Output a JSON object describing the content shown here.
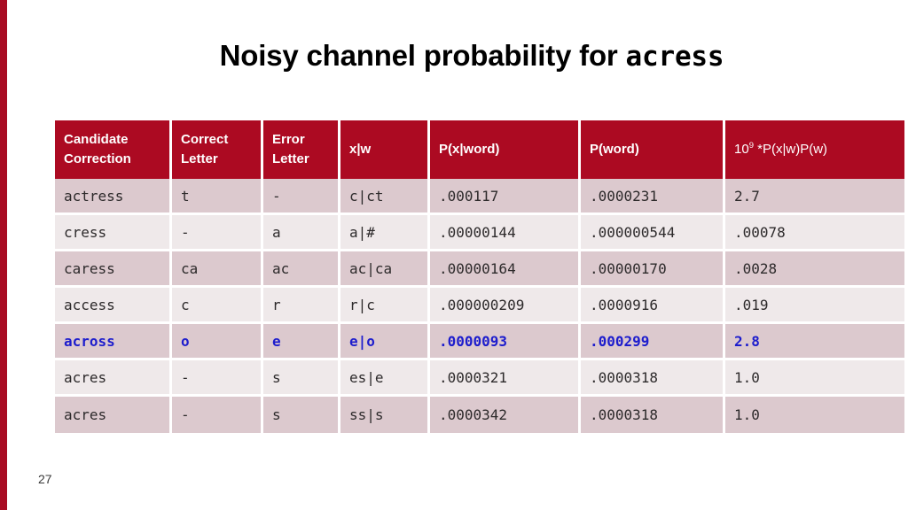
{
  "slide": {
    "title_prefix": "Noisy channel probability for ",
    "title_word": "acress",
    "page_number": "27",
    "accent_red": "#ac0a22",
    "highlight_blue": "#1d1dcd",
    "row_dark": "#dcc9ce",
    "row_light": "#efe9ea"
  },
  "table": {
    "headers": [
      {
        "line1": "Candidate",
        "line2": "Correction"
      },
      {
        "line1": "Correct",
        "line2": "Letter"
      },
      {
        "line1": "Error",
        "line2": "Letter"
      },
      {
        "line1": "x|w",
        "line2": ""
      },
      {
        "line1": "P(x|word)",
        "line2": ""
      },
      {
        "line1": "P(word)",
        "line2": ""
      },
      {
        "line1": "10",
        "sup": "9",
        "line1b": " *P(x|w)P(w)",
        "line2": ""
      }
    ],
    "rows": [
      {
        "shade": "dark",
        "highlight": false,
        "candidate": "actress",
        "correct_letter": "t",
        "error_letter": "-",
        "xw": "c|ct",
        "p_x_word": ".000117",
        "p_word": ".0000231",
        "product": "2.7"
      },
      {
        "shade": "light",
        "highlight": false,
        "candidate": "cress",
        "correct_letter": "-",
        "error_letter": "a",
        "xw": "a|#",
        "p_x_word": ".00000144",
        "p_word": ".000000544",
        "product": ".00078"
      },
      {
        "shade": "dark",
        "highlight": false,
        "candidate": "caress",
        "correct_letter": "ca",
        "error_letter": "ac",
        "xw": "ac|ca",
        "p_x_word": ".00000164",
        "p_word": ".00000170",
        "product": ".0028"
      },
      {
        "shade": "light",
        "highlight": false,
        "candidate": "access",
        "correct_letter": "c",
        "error_letter": "r",
        "xw": "r|c",
        "p_x_word": ".000000209",
        "p_word": ".0000916",
        "product": ".019"
      },
      {
        "shade": "dark",
        "highlight": true,
        "candidate": "across",
        "correct_letter": "o",
        "error_letter": "e",
        "xw": "e|o",
        "p_x_word": ".0000093",
        "p_word": ".000299",
        "product": "2.8"
      },
      {
        "shade": "light",
        "highlight": false,
        "candidate": "acres",
        "correct_letter": "-",
        "error_letter": "s",
        "xw": "es|e",
        "p_x_word": ".0000321",
        "p_word": ".0000318",
        "product": "1.0"
      },
      {
        "shade": "dark",
        "highlight": false,
        "candidate": "acres",
        "correct_letter": "-",
        "error_letter": "s",
        "xw": "ss|s",
        "p_x_word": ".0000342",
        "p_word": ".0000318",
        "product": "1.0"
      }
    ]
  }
}
